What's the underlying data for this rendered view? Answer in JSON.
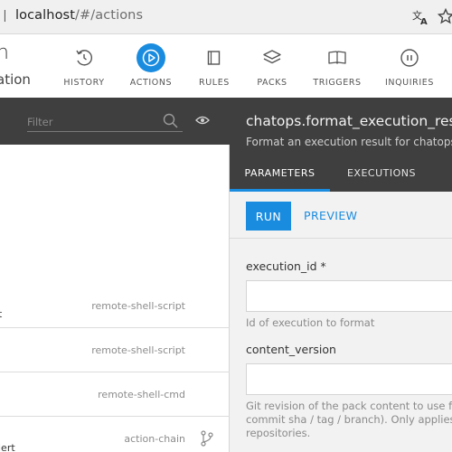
{
  "browser": {
    "url_host": "localhost",
    "url_path": "/#/actions",
    "icons": [
      "page-info-icon",
      "translate-icon",
      "bookmark-star-icon"
    ]
  },
  "app": {
    "logo_line1": "n",
    "logo_line2": "ation"
  },
  "nav": {
    "active": "actions",
    "active_color": "#1a8cdf",
    "items": [
      {
        "key": "history",
        "label": "HISTORY",
        "icon": "history-icon"
      },
      {
        "key": "actions",
        "label": "ACTIONS",
        "icon": "play-icon"
      },
      {
        "key": "rules",
        "label": "RULES",
        "icon": "rules-icon"
      },
      {
        "key": "packs",
        "label": "PACKS",
        "icon": "packs-icon"
      },
      {
        "key": "triggers",
        "label": "TRIGGERS",
        "icon": "triggers-icon"
      },
      {
        "key": "inquiries",
        "label": "INQUIRIES",
        "icon": "inquiries-icon"
      }
    ]
  },
  "sidebar": {
    "filter_placeholder": "Filter",
    "actions": [
      {
        "name": "t",
        "runner": "remote-shell-script"
      },
      {
        "name": "",
        "runner": "remote-shell-script"
      },
      {
        "name": "",
        "runner": "remote-shell-cmd"
      },
      {
        "name": "lert",
        "runner": "action-chain",
        "icon": "workflow-icon"
      }
    ]
  },
  "detail": {
    "title": "chatops.format_execution_result",
    "description": "Format an execution result for chatops",
    "tabs": {
      "parameters": "PARAMETERS",
      "executions": "EXECUTIONS"
    },
    "run_label": "RUN",
    "preview_label": "PREVIEW",
    "fields": [
      {
        "label": "execution_id *",
        "value": "",
        "help": "Id of execution to format"
      },
      {
        "label": "content_version",
        "value": "",
        "help_lines": [
          "Git revision of the pack content to use for",
          "commit sha / tag / branch). Only applies",
          "repositories."
        ]
      }
    ]
  },
  "colors": {
    "accent": "#1a8cdf",
    "dark_panel": "#3f3f3f"
  }
}
